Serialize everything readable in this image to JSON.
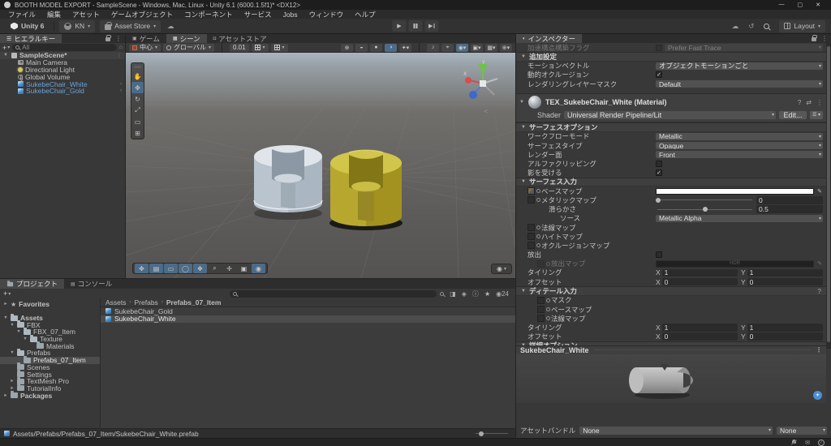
{
  "title_bar": {
    "title": "BOOTH MODEL EXPORT - SampleScene - Windows, Mac, Linux - Unity 6.1 (6000.1.5f1)* <DX12>",
    "minimize": "—",
    "maximize": "▢",
    "close": "✕"
  },
  "menu": {
    "items": [
      "ファイル",
      "編集",
      "アセット",
      "ゲームオブジェクト",
      "コンポーネント",
      "サービス",
      "Jobs",
      "ウィンドウ",
      "ヘルプ"
    ]
  },
  "toolbar": {
    "version": "Unity 6",
    "account": "KN",
    "asset_store": "Asset Store",
    "layout": "Layout",
    "play_icon": "▶"
  },
  "glyphs": {
    "check": "✓",
    "dots": "⋮",
    "chevron": "›",
    "fold_open": "▼",
    "fold_closed": "►",
    "back": "<"
  },
  "hierarchy": {
    "tab": "ヒエラルキー",
    "search": "All",
    "scene": "SampleScene*",
    "items": [
      "Main Camera",
      "Directional Light",
      "Global Volume",
      "SukebeChair_White",
      "SukebeChair_Gold"
    ]
  },
  "scene_view": {
    "tabs": [
      "ゲーム",
      "シーン",
      "アセットストア"
    ],
    "pivot": "中心",
    "orientation": "グローバル",
    "grid_size": "0.01",
    "axis": {
      "x": "X",
      "y": "Y",
      "z": "Z"
    }
  },
  "inspector": {
    "tab": "インスペクター",
    "ray_tracing": {
      "label": "加速構造構築フラグ",
      "value": "Prefer Fast Trace"
    },
    "additional_settings": {
      "header": "追加設定",
      "motion_vectors_label": "モーションベクトル",
      "motion_vectors_value": "オブジェクトモーションごと",
      "dynamic_occlusion_label": "動的オクルージョン",
      "rendering_layer_mask_label": "レンダリングレイヤーマスク",
      "rendering_layer_mask_value": "Default"
    },
    "material": {
      "name": "TEX_SukebeChair_White (Material)",
      "shader_label": "Shader",
      "shader_value": "Universal Render Pipeline/Lit",
      "edit_button": "Edit..."
    },
    "surface_options": {
      "header": "サーフェスオプション",
      "workflow_label": "ワークフローモード",
      "workflow_value": "Metallic",
      "surface_type_label": "サーフェスタイプ",
      "surface_type_value": "Opaque",
      "render_face_label": "レンダー面",
      "render_face_value": "Front",
      "alpha_clipping_label": "アルファクリッピング",
      "receive_shadows_label": "影を受ける"
    },
    "surface_inputs": {
      "header": "サーフェス入力",
      "base_map_label": "ベースマップ",
      "metallic_map_label": "メタリックマップ",
      "metallic_value": "0",
      "smoothness_label": "滑らかさ",
      "smoothness_value": "0.5",
      "source_label": "ソース",
      "source_value": "Metallic Alpha",
      "normal_map_label": "法線マップ",
      "height_map_label": "ハイトマップ",
      "occlusion_map_label": "オクルージョンマップ",
      "emission_label": "放出",
      "emission_map_label": "放出マップ",
      "hdr_label": "HDR",
      "tiling_label": "タイリング",
      "tiling_x": "1",
      "tiling_y": "1",
      "offset_label": "オフセット",
      "offset_x": "0",
      "offset_y": "0"
    },
    "detail_inputs": {
      "header": "ディテール入力",
      "mask_label": "マスク",
      "base_map_label": "ベースマップ",
      "normal_map_label": "法線マップ",
      "tiling_label": "タイリング",
      "tiling_x": "1",
      "tiling_y": "1",
      "offset_label": "オフセット",
      "offset_x": "0",
      "offset_y": "0"
    },
    "advanced_header": "詳細オプション",
    "axis_x": "X",
    "axis_y": "Y",
    "preview": {
      "title": "SukebeChair_White",
      "asset_bundle_label": "アセットバンドル",
      "bundle_value": "None",
      "variant_value": "None"
    }
  },
  "project": {
    "tab": "プロジェクト",
    "console_tab": "コンソール",
    "tree": [
      "Favorites",
      "Assets",
      "FBX",
      "FBX_07_Item",
      "Texture",
      "Materials",
      "Prefabs",
      "Prefabs_07_Item",
      "Scenes",
      "Settings",
      "TextMesh Pro",
      "TutorialInfo",
      "Packages"
    ],
    "breadcrumb": [
      "Assets",
      "Prefabs",
      "Prefabs_07_Item"
    ],
    "files": [
      "SukebeChair_Gold",
      "SukebeChair_White"
    ],
    "hidden_count": "24",
    "status_path": "Assets/Prefabs/Prefabs_07_Item/SukebeChair_White.prefab"
  },
  "colors": {
    "prefab_blue": "#6ba2d6",
    "selection_gray": "#4c4c4c",
    "tool_active_blue": "#4c6b88",
    "chair_white": "#b6c1cb",
    "chair_gold": "#b3a22e"
  }
}
